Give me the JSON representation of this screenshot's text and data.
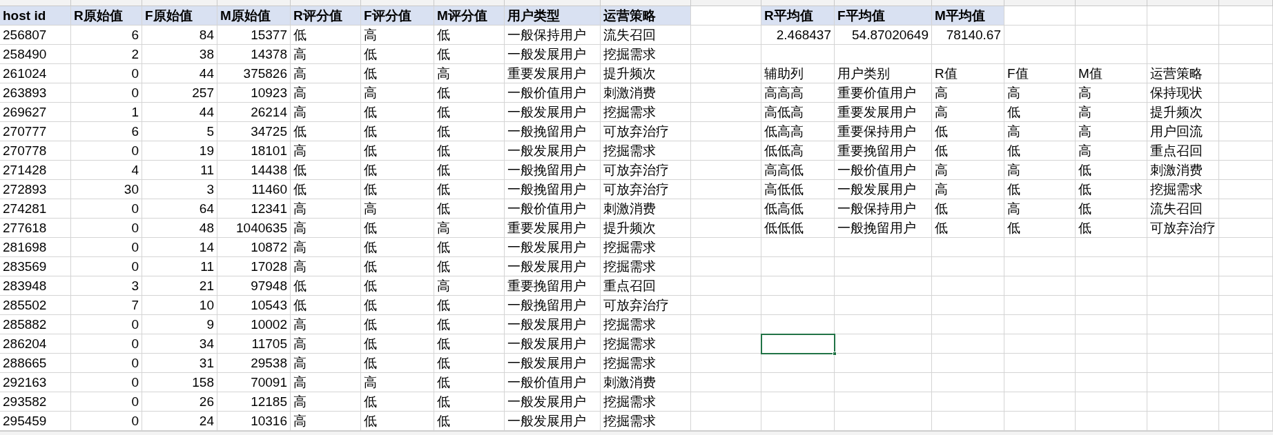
{
  "main_table": {
    "columns": [
      {
        "label": "host id",
        "kind": "text"
      },
      {
        "label": "R原始值",
        "kind": "number"
      },
      {
        "label": "F原始值",
        "kind": "number"
      },
      {
        "label": "M原始值",
        "kind": "number"
      },
      {
        "label": "R评分值",
        "kind": "text"
      },
      {
        "label": "F评分值",
        "kind": "text"
      },
      {
        "label": "M评分值",
        "kind": "text"
      },
      {
        "label": "用户类型",
        "kind": "text"
      },
      {
        "label": "运营策略",
        "kind": "text"
      }
    ],
    "rows": [
      [
        "256807",
        "6",
        "84",
        "15377",
        "低",
        "高",
        "低",
        "一般保持用户",
        "流失召回"
      ],
      [
        "258490",
        "2",
        "38",
        "14378",
        "高",
        "低",
        "低",
        "一般发展用户",
        "挖掘需求"
      ],
      [
        "261024",
        "0",
        "44",
        "375826",
        "高",
        "低",
        "高",
        "重要发展用户",
        "提升频次"
      ],
      [
        "263893",
        "0",
        "257",
        "10923",
        "高",
        "高",
        "低",
        "一般价值用户",
        "刺激消费"
      ],
      [
        "269627",
        "1",
        "44",
        "26214",
        "高",
        "低",
        "低",
        "一般发展用户",
        "挖掘需求"
      ],
      [
        "270777",
        "6",
        "5",
        "34725",
        "低",
        "低",
        "低",
        "一般挽留用户",
        "可放弃治疗"
      ],
      [
        "270778",
        "0",
        "19",
        "18101",
        "高",
        "低",
        "低",
        "一般发展用户",
        "挖掘需求"
      ],
      [
        "271428",
        "4",
        "11",
        "14438",
        "低",
        "低",
        "低",
        "一般挽留用户",
        "可放弃治疗"
      ],
      [
        "272893",
        "30",
        "3",
        "11460",
        "低",
        "低",
        "低",
        "一般挽留用户",
        "可放弃治疗"
      ],
      [
        "274281",
        "0",
        "64",
        "12341",
        "高",
        "高",
        "低",
        "一般价值用户",
        "刺激消费"
      ],
      [
        "277618",
        "0",
        "48",
        "1040635",
        "高",
        "低",
        "高",
        "重要发展用户",
        "提升频次"
      ],
      [
        "281698",
        "0",
        "14",
        "10872",
        "高",
        "低",
        "低",
        "一般发展用户",
        "挖掘需求"
      ],
      [
        "283569",
        "0",
        "11",
        "17028",
        "高",
        "低",
        "低",
        "一般发展用户",
        "挖掘需求"
      ],
      [
        "283948",
        "3",
        "21",
        "97948",
        "低",
        "低",
        "高",
        "重要挽留用户",
        "重点召回"
      ],
      [
        "285502",
        "7",
        "10",
        "10543",
        "低",
        "低",
        "低",
        "一般挽留用户",
        "可放弃治疗"
      ],
      [
        "285882",
        "0",
        "9",
        "10002",
        "高",
        "低",
        "低",
        "一般发展用户",
        "挖掘需求"
      ],
      [
        "286204",
        "0",
        "34",
        "11705",
        "高",
        "低",
        "低",
        "一般发展用户",
        "挖掘需求"
      ],
      [
        "288665",
        "0",
        "31",
        "29538",
        "高",
        "低",
        "低",
        "一般发展用户",
        "挖掘需求"
      ],
      [
        "292163",
        "0",
        "158",
        "70091",
        "高",
        "高",
        "低",
        "一般价值用户",
        "刺激消费"
      ],
      [
        "293582",
        "0",
        "26",
        "12185",
        "高",
        "低",
        "低",
        "一般发展用户",
        "挖掘需求"
      ],
      [
        "295459",
        "0",
        "24",
        "10316",
        "高",
        "低",
        "低",
        "一般发展用户",
        "挖掘需求"
      ]
    ]
  },
  "averages": {
    "columns": [
      "R平均值",
      "F平均值",
      "M平均值"
    ],
    "values": [
      "2.468437",
      "54.87020649",
      "78140.67"
    ]
  },
  "lookup_table": {
    "columns": [
      "辅助列",
      "用户类别",
      "R值",
      "F值",
      "M值",
      "运营策略"
    ],
    "rows": [
      [
        "高高高",
        "重要价值用户",
        "高",
        "高",
        "高",
        "保持现状"
      ],
      [
        "高低高",
        "重要发展用户",
        "高",
        "低",
        "高",
        "提升频次"
      ],
      [
        "低高高",
        "重要保持用户",
        "低",
        "高",
        "高",
        "用户回流"
      ],
      [
        "低低高",
        "重要挽留用户",
        "低",
        "低",
        "高",
        "重点召回"
      ],
      [
        "高高低",
        "一般价值用户",
        "高",
        "高",
        "低",
        "刺激消费"
      ],
      [
        "高低低",
        "一般发展用户",
        "高",
        "低",
        "低",
        "挖掘需求"
      ],
      [
        "低高低",
        "一般保持用户",
        "低",
        "高",
        "低",
        "流失召回"
      ],
      [
        "低低低",
        "一般挽留用户",
        "低",
        "低",
        "低",
        "可放弃治疗"
      ]
    ]
  },
  "active_cell": {
    "selected": true
  }
}
